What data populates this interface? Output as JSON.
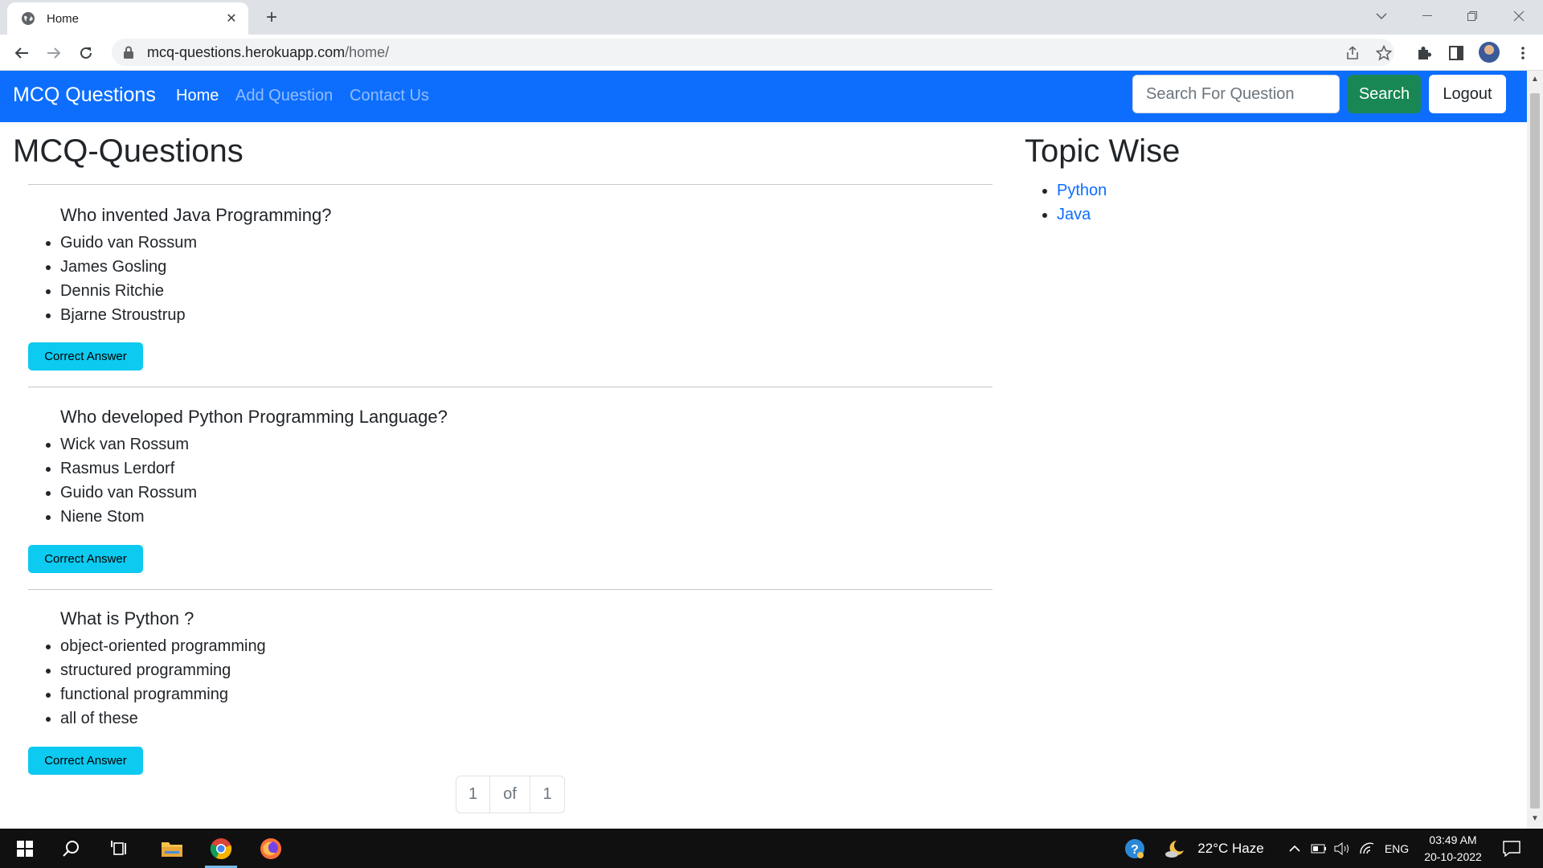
{
  "browser": {
    "tab_title": "Home",
    "url_host": "mcq-questions.herokuapp.com",
    "url_path": "/home/"
  },
  "navbar": {
    "brand": "MCQ Questions",
    "links": [
      "Home",
      "Add Question",
      "Contact Us"
    ],
    "search_placeholder": "Search For Question",
    "search_button": "Search",
    "logout_button": "Logout",
    "color": "#0d6efd"
  },
  "main": {
    "title": "MCQ-Questions",
    "answer_button_label": "Correct Answer",
    "questions": [
      {
        "text": "Who invented Java Programming?",
        "options": [
          "Guido van Rossum",
          "James Gosling",
          "Dennis Ritchie",
          "Bjarne Stroustrup"
        ],
        "button": "Correct Answer"
      },
      {
        "text": "Who developed Python Programming Language?",
        "options": [
          "Wick van Rossum",
          "Rasmus Lerdorf",
          "Guido van Rossum",
          "Niene Stom"
        ],
        "button": "Correct Answer"
      },
      {
        "text": "What is Python ?",
        "options": [
          "object-oriented programming",
          "structured programming",
          "functional programming",
          "all of these"
        ],
        "button": "Correct Answer"
      }
    ],
    "pagination": {
      "current": "1",
      "of": "of",
      "total": "1"
    }
  },
  "sidebar": {
    "title": "Topic Wise",
    "topics": [
      "Python",
      "Java"
    ]
  },
  "taskbar": {
    "weather": "22°C  Haze",
    "language": "ENG",
    "time": "03:49 AM",
    "date": "20-10-2022"
  }
}
